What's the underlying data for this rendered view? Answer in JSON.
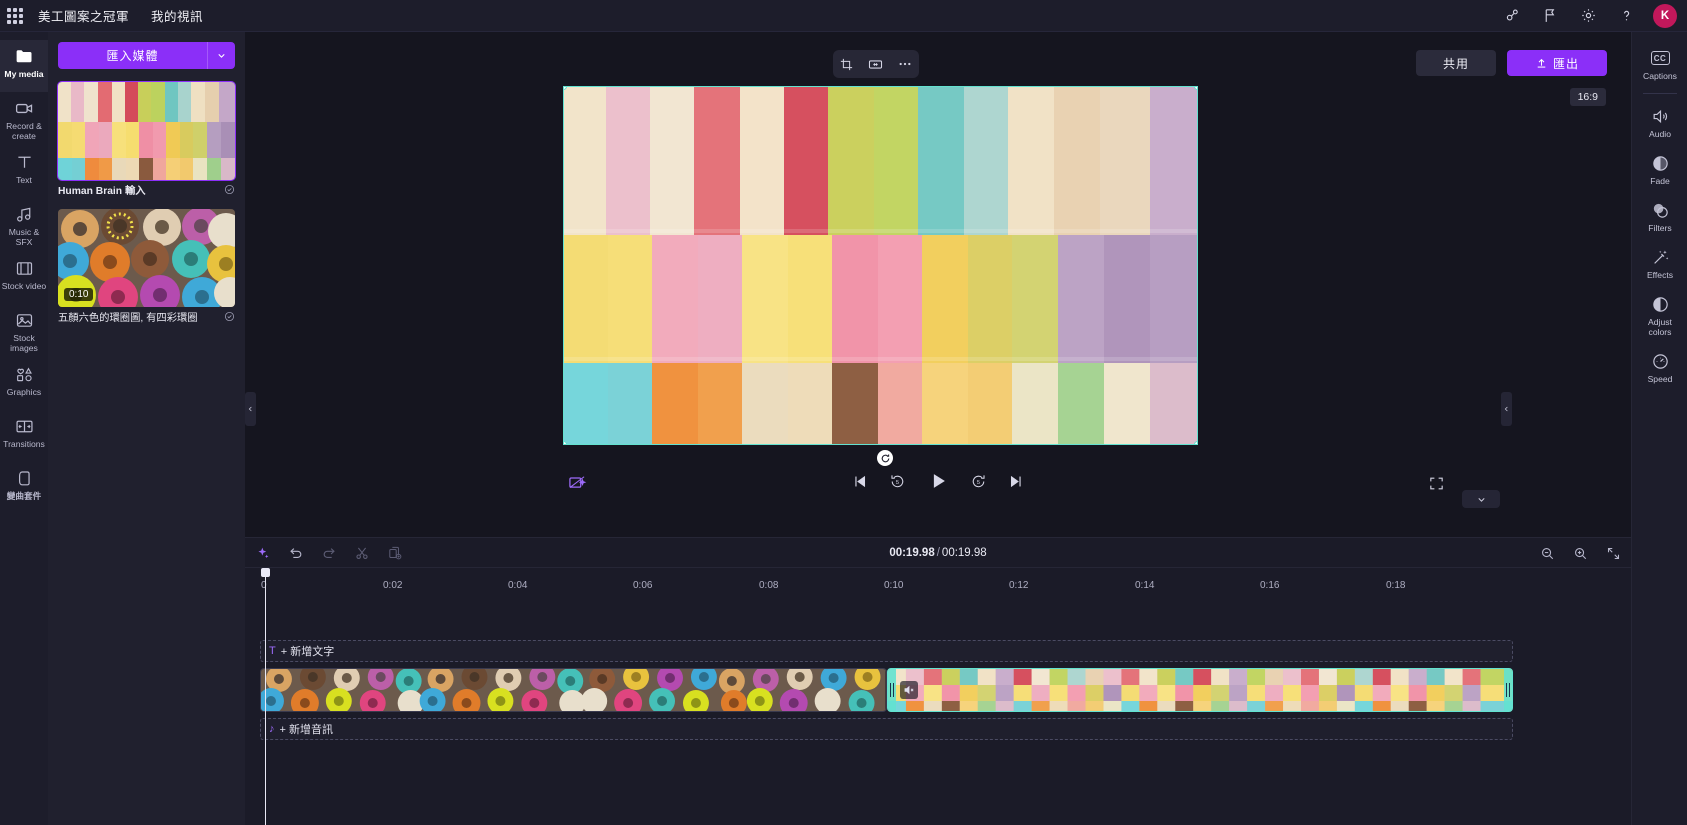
{
  "topbar": {
    "app_grid_icon": "waffle-grid-icon",
    "brand_title": "美工圖案之冠軍",
    "project_title": "我的視訊",
    "icons": [
      {
        "name": "people-share-icon",
        "glyph": "people"
      },
      {
        "name": "flag-feedback-icon",
        "glyph": "flag"
      },
      {
        "name": "settings-gear-icon",
        "glyph": "gear"
      },
      {
        "name": "help-icon",
        "glyph": "?"
      }
    ],
    "avatar_initial": "K",
    "avatar_color": "#c2185b"
  },
  "left_rail": {
    "items": [
      {
        "label": "My media",
        "icon": "folder-icon",
        "active": true
      },
      {
        "label": "Record &\ncreate",
        "icon": "camera-icon",
        "active": false
      },
      {
        "label": "Text",
        "icon": "text-t-icon",
        "active": false
      },
      {
        "label": "Music & SFX",
        "icon": "music-note-icon",
        "active": false
      },
      {
        "label": "Stock video",
        "icon": "film-strip-icon",
        "active": false
      },
      {
        "label": "Stock\nimages",
        "icon": "image-icon",
        "active": false
      },
      {
        "label": "Graphics",
        "icon": "shapes-icon",
        "active": false
      },
      {
        "label": "Transitions",
        "icon": "transitions-icon",
        "active": false
      },
      {
        "label": "變曲套件",
        "icon": "brand-kit-icon",
        "active": false
      }
    ]
  },
  "media_panel": {
    "import_label": "匯入媒體",
    "import_caret_icon": "chevron-down-icon",
    "accent_color": "#8b2ff8",
    "items": [
      {
        "title": "Human Brain 輸入",
        "duration": "",
        "badge_icon": "check-circle-icon",
        "selected": true,
        "bold": true
      },
      {
        "title": "五顏六色的環圈圖, 有四彩環圈",
        "duration": "0:10",
        "badge_icon": "check-circle-icon",
        "selected": false,
        "bold": false
      }
    ]
  },
  "preview": {
    "float_tools": [
      {
        "name": "crop-icon",
        "label": "crop"
      },
      {
        "name": "fit-resize-icon",
        "label": "fit"
      },
      {
        "name": "more-options-icon",
        "label": "more"
      }
    ],
    "share_label": "共用",
    "export_label": "匯出",
    "export_icon": "upload-arrow-icon",
    "aspect_ratio": "16:9",
    "selection_color": "#63e2d0",
    "rotate_icon": "rotate-icon",
    "auto_compose_icon": "auto-compose-icon",
    "playback": [
      {
        "name": "skip-to-start-button",
        "glyph": "skip-start"
      },
      {
        "name": "rewind-5s-button",
        "glyph": "back5"
      },
      {
        "name": "play-button",
        "glyph": "play"
      },
      {
        "name": "forward-5s-button",
        "glyph": "fwd5"
      },
      {
        "name": "skip-to-end-button",
        "glyph": "skip-end"
      }
    ],
    "fullscreen_icon": "fullscreen-icon",
    "collapse_icon": "chevron-down-icon"
  },
  "timeline": {
    "tools": [
      {
        "name": "magic-ai-button",
        "icon": "sparkle-icon",
        "accent": true
      },
      {
        "name": "undo-button",
        "icon": "undo-arrow-icon",
        "accent": false
      },
      {
        "name": "redo-button",
        "icon": "redo-arrow-icon",
        "accent": false
      },
      {
        "name": "split-button",
        "icon": "scissors-icon",
        "accent": false
      },
      {
        "name": "duplicate-button",
        "icon": "duplicate-icon",
        "accent": false
      }
    ],
    "current_time": "00:19.98",
    "time_separator": "/",
    "total_time": "00:19.98",
    "zoom_controls": [
      {
        "name": "zoom-out-button",
        "icon": "magnifier-minus-icon"
      },
      {
        "name": "zoom-in-button",
        "icon": "magnifier-plus-icon"
      },
      {
        "name": "fit-timeline-button",
        "icon": "fit-arrows-icon"
      }
    ],
    "ruler_ticks": [
      "0",
      "0:02",
      "0:04",
      "0:06",
      "0:08",
      "0:10",
      "0:12",
      "0:14",
      "0:16",
      "0:18"
    ],
    "add_text_track": {
      "glyph": "T",
      "label": "+ 新增文字"
    },
    "add_audio_track": {
      "glyph": "♪",
      "label": "+ 新增音訊"
    },
    "clips": [
      {
        "name": "video-clip-donuts",
        "width_pct": 50,
        "selected": false,
        "muted": false
      },
      {
        "name": "video-clip-macarons",
        "width_pct": 50,
        "selected": true,
        "muted": true
      }
    ]
  },
  "right_rail": {
    "items": [
      {
        "label": "Captions",
        "icon": "cc-icon",
        "divider_after": true
      },
      {
        "label": "Audio",
        "icon": "speaker-icon",
        "divider_after": false
      },
      {
        "label": "Fade",
        "icon": "fade-circle-icon",
        "divider_after": false
      },
      {
        "label": "Filters",
        "icon": "filters-circles-icon",
        "divider_after": false
      },
      {
        "label": "Effects",
        "icon": "magic-wand-icon",
        "divider_after": false
      },
      {
        "label": "Adjust\ncolors",
        "icon": "half-circle-icon",
        "divider_after": false
      },
      {
        "label": "Speed",
        "icon": "speedometer-icon",
        "divider_after": false
      }
    ]
  }
}
